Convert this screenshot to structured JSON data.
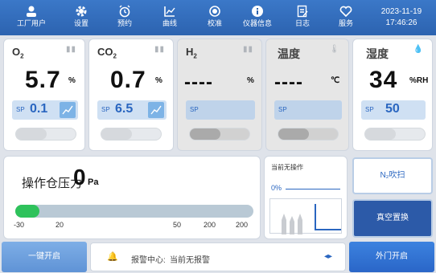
{
  "nav": {
    "items": [
      {
        "label": "工厂用户",
        "icon": "user-icon"
      },
      {
        "label": "设置",
        "icon": "gear-icon"
      },
      {
        "label": "预约",
        "icon": "alarm-clock-icon"
      },
      {
        "label": "曲线",
        "icon": "chart-icon"
      },
      {
        "label": "校准",
        "icon": "target-icon"
      },
      {
        "label": "仪器信息",
        "icon": "info-icon"
      },
      {
        "label": "日志",
        "icon": "log-icon"
      },
      {
        "label": "服务",
        "icon": "service-icon"
      }
    ],
    "date": "2023-11-19",
    "time": "17:46:26"
  },
  "gases": [
    {
      "name": "O",
      "sub": "2",
      "value": "5.7",
      "unit": "%",
      "sp_label": "SP",
      "sp_value": "0.1",
      "enabled": true
    },
    {
      "name": "CO",
      "sub": "2",
      "value": "0.7",
      "unit": "%",
      "sp_label": "SP",
      "sp_value": "6.5",
      "enabled": true
    },
    {
      "name": "H",
      "sub": "2",
      "value": "----",
      "unit": "%",
      "sp_label": "SP",
      "sp_value": "",
      "enabled": false
    },
    {
      "name": "温度",
      "sub": "",
      "value": "----",
      "unit": "℃",
      "sp_label": "SP",
      "sp_value": "",
      "enabled": false
    },
    {
      "name": "湿度",
      "sub": "",
      "value": "34",
      "unit": "%RH",
      "sp_label": "SP",
      "sp_value": "50",
      "enabled": true
    }
  ],
  "pressure": {
    "title": "操作仓压力",
    "value": "0",
    "unit": "Pa",
    "level_fraction": 0.1,
    "ticks": [
      "-30",
      "20",
      "50",
      "200",
      "200"
    ]
  },
  "operation": {
    "title": "当前无操作",
    "percent": "0%"
  },
  "right_buttons": {
    "n2_purge": "N₂吹扫",
    "vacuum": "真空置换"
  },
  "bottom": {
    "one_key": "一键开启",
    "alarm_label": "报警中心:",
    "alarm_text": "当前无报警",
    "outer_door": "外门开启"
  },
  "colors": {
    "accent": "#2f6cc0",
    "enabled_sp": "#2a66c0",
    "pressure_fill": "#2ec25b"
  }
}
